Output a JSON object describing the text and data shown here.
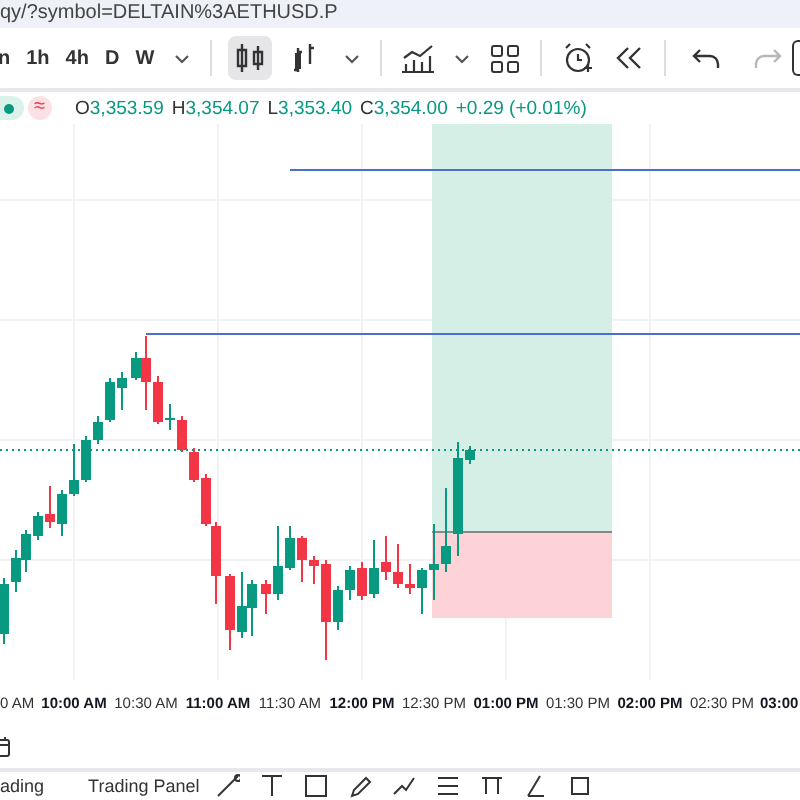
{
  "address_bar": {
    "url": "qy/?symbol=DELTAIN%3AETHUSD.P"
  },
  "toolbar": {
    "intervals": [
      {
        "label": "n",
        "selected": false
      },
      {
        "label": "1h",
        "selected": false
      },
      {
        "label": "4h",
        "selected": false
      },
      {
        "label": "D",
        "selected": false
      },
      {
        "label": "W",
        "selected": false
      }
    ],
    "chart_styles": [
      {
        "kind": "candles",
        "selected": true
      },
      {
        "kind": "bars",
        "selected": false
      }
    ],
    "undo": {
      "disabled": false
    },
    "redo": {
      "disabled": true
    }
  },
  "legend": {
    "status_symbol": "≈",
    "values": [
      {
        "label": "O",
        "value": "3,353.59"
      },
      {
        "label": "H",
        "value": "3,354.07"
      },
      {
        "label": "L",
        "value": "3,353.40"
      },
      {
        "label": "C",
        "value": "3,354.00"
      }
    ],
    "change": "+0.29 (+0.01%)"
  },
  "time_axis": {
    "labels": [
      {
        "text": "0 AM",
        "major": false
      },
      {
        "text": "10:00 AM",
        "major": true
      },
      {
        "text": "10:30 AM",
        "major": false
      },
      {
        "text": "11:00 AM",
        "major": true
      },
      {
        "text": "11:30 AM",
        "major": false
      },
      {
        "text": "12:00 PM",
        "major": true
      },
      {
        "text": "12:30 PM",
        "major": false
      },
      {
        "text": "01:00 PM",
        "major": true
      },
      {
        "text": "01:30 PM",
        "major": false
      },
      {
        "text": "02:00 PM",
        "major": true
      },
      {
        "text": "02:30 PM",
        "major": false
      },
      {
        "text": "03:00",
        "major": true
      }
    ]
  },
  "bottom_tabs": [
    {
      "label": "ading"
    },
    {
      "label": "Trading Panel"
    }
  ]
}
